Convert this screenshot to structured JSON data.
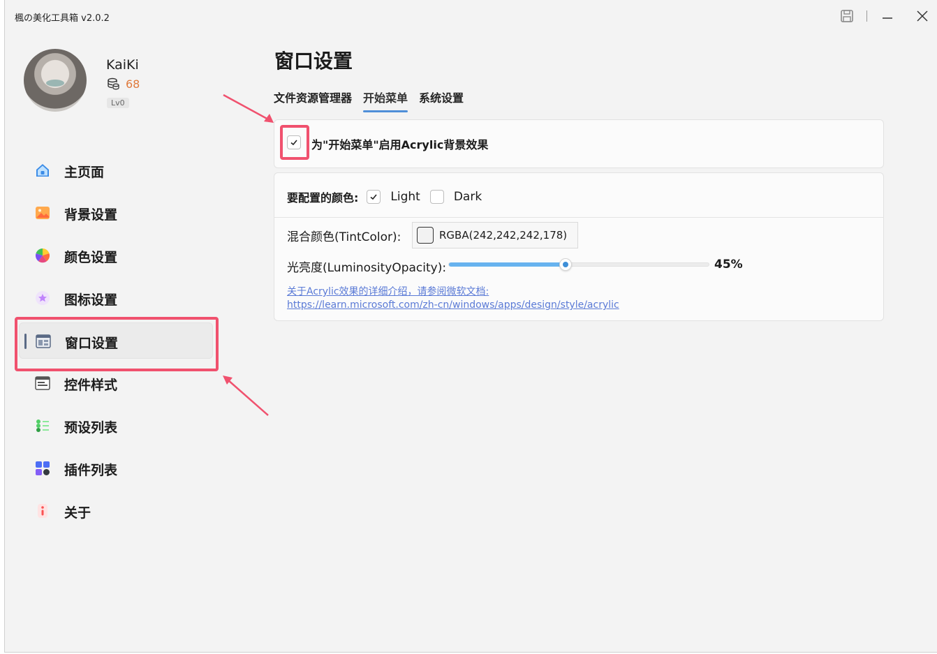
{
  "window": {
    "title": "楓の美化工具箱 v2.0.2"
  },
  "titlebar": {
    "icons": [
      "save-icon",
      "minimize-icon",
      "close-icon"
    ]
  },
  "user": {
    "name": "KaiKi",
    "coins": "68",
    "level": "Lv0"
  },
  "sidebar": {
    "items": [
      {
        "label": "主页面",
        "icon": "home-icon"
      },
      {
        "label": "背景设置",
        "icon": "image-icon"
      },
      {
        "label": "颜色设置",
        "icon": "color-wheel-icon"
      },
      {
        "label": "图标设置",
        "icon": "star-icon"
      },
      {
        "label": "窗口设置",
        "icon": "window-icon",
        "active": true
      },
      {
        "label": "控件样式",
        "icon": "widget-icon"
      },
      {
        "label": "预设列表",
        "icon": "list-icon"
      },
      {
        "label": "插件列表",
        "icon": "plugin-icon"
      },
      {
        "label": "关于",
        "icon": "info-icon"
      }
    ]
  },
  "main": {
    "title": "窗口设置",
    "tabs": [
      {
        "label": "文件资源管理器"
      },
      {
        "label": "开始菜单",
        "active": true
      },
      {
        "label": "系统设置"
      }
    ],
    "acrylic_toggle": {
      "label": "为\"开始菜单\"启用Acrylic背景效果",
      "checked": true
    },
    "color_target": {
      "label": "要配置的颜色:",
      "light": "Light",
      "light_checked": true,
      "dark": "Dark",
      "dark_checked": false
    },
    "tint": {
      "label": "混合颜色(TintColor):",
      "value": "RGBA(242,242,242,178)",
      "swatch": "#f2f2f2"
    },
    "luminosity": {
      "label": "光亮度(LuminosityOpacity):",
      "value_text": "45%",
      "value": 0.45
    },
    "doc": {
      "line1": "关于Acrylic效果的详细介绍，请参阅微软文档:",
      "line2": "https://learn.microsoft.com/zh-cn/windows/apps/design/style/acrylic"
    }
  },
  "colors": {
    "accent": "#4f8fd8",
    "highlight": "#f0516e",
    "coin": "#e07a3c",
    "link": "#5a7ad6"
  }
}
